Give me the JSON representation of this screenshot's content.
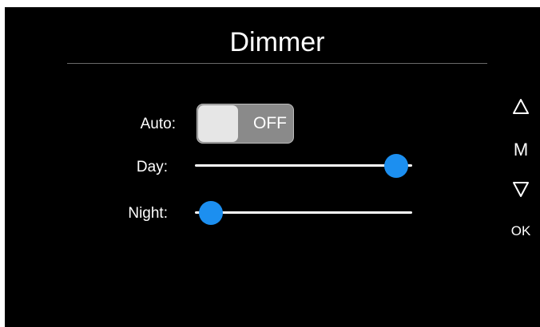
{
  "screen": {
    "title": "Dimmer"
  },
  "settings": {
    "auto": {
      "label": "Auto:",
      "state": "OFF"
    },
    "day": {
      "label": "Day:",
      "level": 1.0
    },
    "night": {
      "label": "Night:",
      "level": 0.0
    }
  },
  "side_buttons": {
    "up_icon": "up-triangle-outline",
    "mode_label": "M",
    "down_icon": "down-triangle-outline",
    "ok_label": "OK"
  },
  "colors": {
    "background": "#000000",
    "accent": "#1c8ff0",
    "toggle_off": "#8a8a8a"
  }
}
